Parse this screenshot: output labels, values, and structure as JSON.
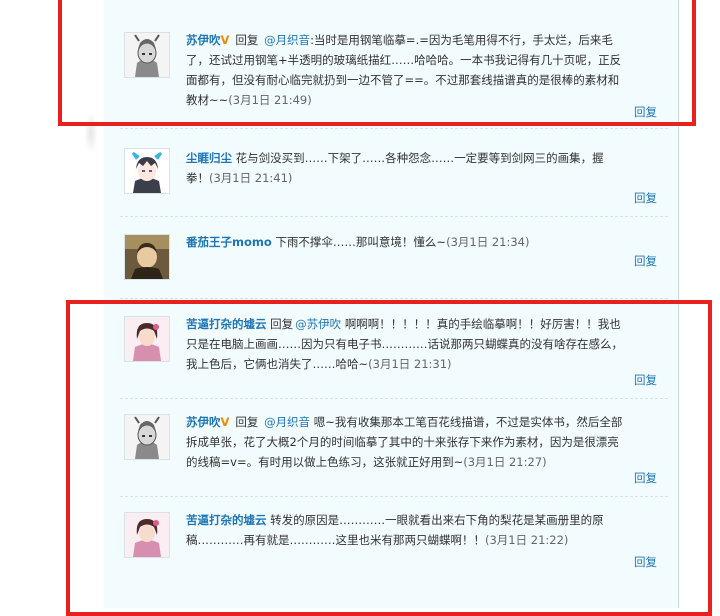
{
  "comments": [
    {
      "user": "苏伊吹",
      "vip": "V",
      "reply_word": "回复",
      "mention": "@月织音",
      "text": ":当时是用钢笔临摹=.=因为毛笔用得不行，手太烂，后来毛了，还试过用钢笔+半透明的玻璃纸描红……哈哈哈。一本书我记得有几十页呢，正反面都有，但没有耐心临完就扔到一边不管了==。不过那套线描谱真的是很棒的素材和教材~~",
      "time": "(3月1日 21:49)",
      "reply_link": "回复",
      "avatar_icon": "gray-character-avatar"
    },
    {
      "user": "尘睚归尘",
      "vip": "",
      "reply_word": "",
      "mention": "",
      "text": "花与剑没买到……下架了……各种怨念……一定要等到剑网三的画集，握拳！",
      "time": "(3月1日 21:41)",
      "reply_link": "回复",
      "avatar_icon": "anime-boy-avatar"
    },
    {
      "user": "番茄王子momo",
      "vip": "",
      "reply_word": "",
      "mention": "",
      "text": "下雨不撑伞……那叫意境！懂么~",
      "time": "(3月1日 21:34)",
      "reply_link": "回复",
      "avatar_icon": "photo-avatar"
    },
    {
      "user": "苦逼打杂的墟云",
      "vip": "",
      "reply_word": "回复",
      "mention": "@苏伊吹",
      "text": "啊啊啊！！！！！真的手绘临摹啊！！好厉害！！我也只是在电脑上画画……因为只有电子书…………话说那两只蝴蝶真的没有啥存在感么，我上色后，它俩也消失了……哈哈~",
      "time": "(3月1日 21:31)",
      "reply_link": "回复",
      "avatar_icon": "girl-portrait-avatar"
    },
    {
      "user": "苏伊吹",
      "vip": "V",
      "reply_word": "回复",
      "mention": "@月织音",
      "text": "嗯~我有收集那本工笔百花线描谱，不过是实体书，然后全部拆成单张，花了大概2个月的时间临摹了其中的十来张存下来作为素材，因为是很漂亮的线稿=v=。有时用以做上色练习，这张就正好用到~",
      "time": "(3月1日 21:27)",
      "reply_link": "回复",
      "avatar_icon": "gray-character-avatar"
    },
    {
      "user": "苦逼打杂的墟云",
      "vip": "",
      "reply_word": "",
      "mention": "",
      "text": "转发的原因是…………一眼就看出来右下角的梨花是某画册里的原稿…………再有就是…………这里也米有那两只蝴蝶啊！！",
      "time": "(3月1日 21:22)",
      "reply_link": "回复",
      "avatar_icon": "girl-portrait-avatar"
    }
  ],
  "colors": {
    "link": "#1e76b5",
    "vip": "#f08a00",
    "highlight": "#e8211f",
    "panel": "#f2fbfe"
  }
}
